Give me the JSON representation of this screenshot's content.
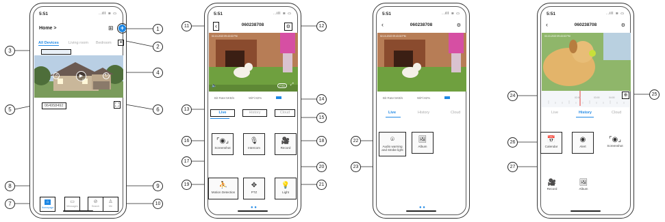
{
  "status_time": "5:51",
  "status_icons": "..ill ≋ ▭",
  "phone1": {
    "home_title": "Home",
    "home_chevron": ">",
    "grid_icon": "⊞",
    "add_icon": "+",
    "tabs": [
      "All Devices",
      "Living room",
      "Bedroom"
    ],
    "menu_icon": "≡",
    "device_id": "064958492",
    "expand_icon": "⛶",
    "nav": [
      "Homepage",
      "Messages",
      "Search",
      "Me"
    ]
  },
  "phone2": {
    "title": "060238708",
    "timestamp": "02-10-2022 09:43:02 PM",
    "quality": "FHD",
    "bit_rate": "Bit Rate:5KB/s",
    "wifi": "WiFi:82%",
    "tabs": [
      "Live",
      "History",
      "Cloud"
    ],
    "tiles": [
      "Screenshot",
      "Intercom",
      "Record",
      "Motion Detection",
      "PTZ",
      "Light"
    ]
  },
  "phone3": {
    "title": "060238708",
    "timestamp": "02-10-2022 09:43:02 PM",
    "bit_rate": "Bit Rate:5KB/s",
    "wifi": "WiFi:82%",
    "tabs": [
      "Live",
      "History",
      "Cloud"
    ],
    "tiles": [
      "Audio warning and strobe light",
      "Album"
    ]
  },
  "phone4": {
    "title": "060238708",
    "timestamp": "02-10-2022 09:43:02 PM",
    "timeline": [
      "02:00",
      "03:00",
      "04:00"
    ],
    "zoom_icon": "⊕",
    "tabs": [
      "Live",
      "History",
      "Cloud"
    ],
    "tiles": [
      "Calendar",
      "Alert",
      "Screenshot",
      "Record",
      "Album"
    ]
  },
  "callouts": [
    "1",
    "2",
    "3",
    "4",
    "5",
    "6",
    "7",
    "8",
    "9",
    "10",
    "11",
    "12",
    "13",
    "14",
    "15",
    "16",
    "17",
    "18",
    "19",
    "20",
    "21",
    "22",
    "23",
    "24",
    "25",
    "26",
    "27"
  ],
  "colors": {
    "accent": "#1e88e5",
    "play": "#ffffff",
    "alert_red": "#e53935"
  }
}
